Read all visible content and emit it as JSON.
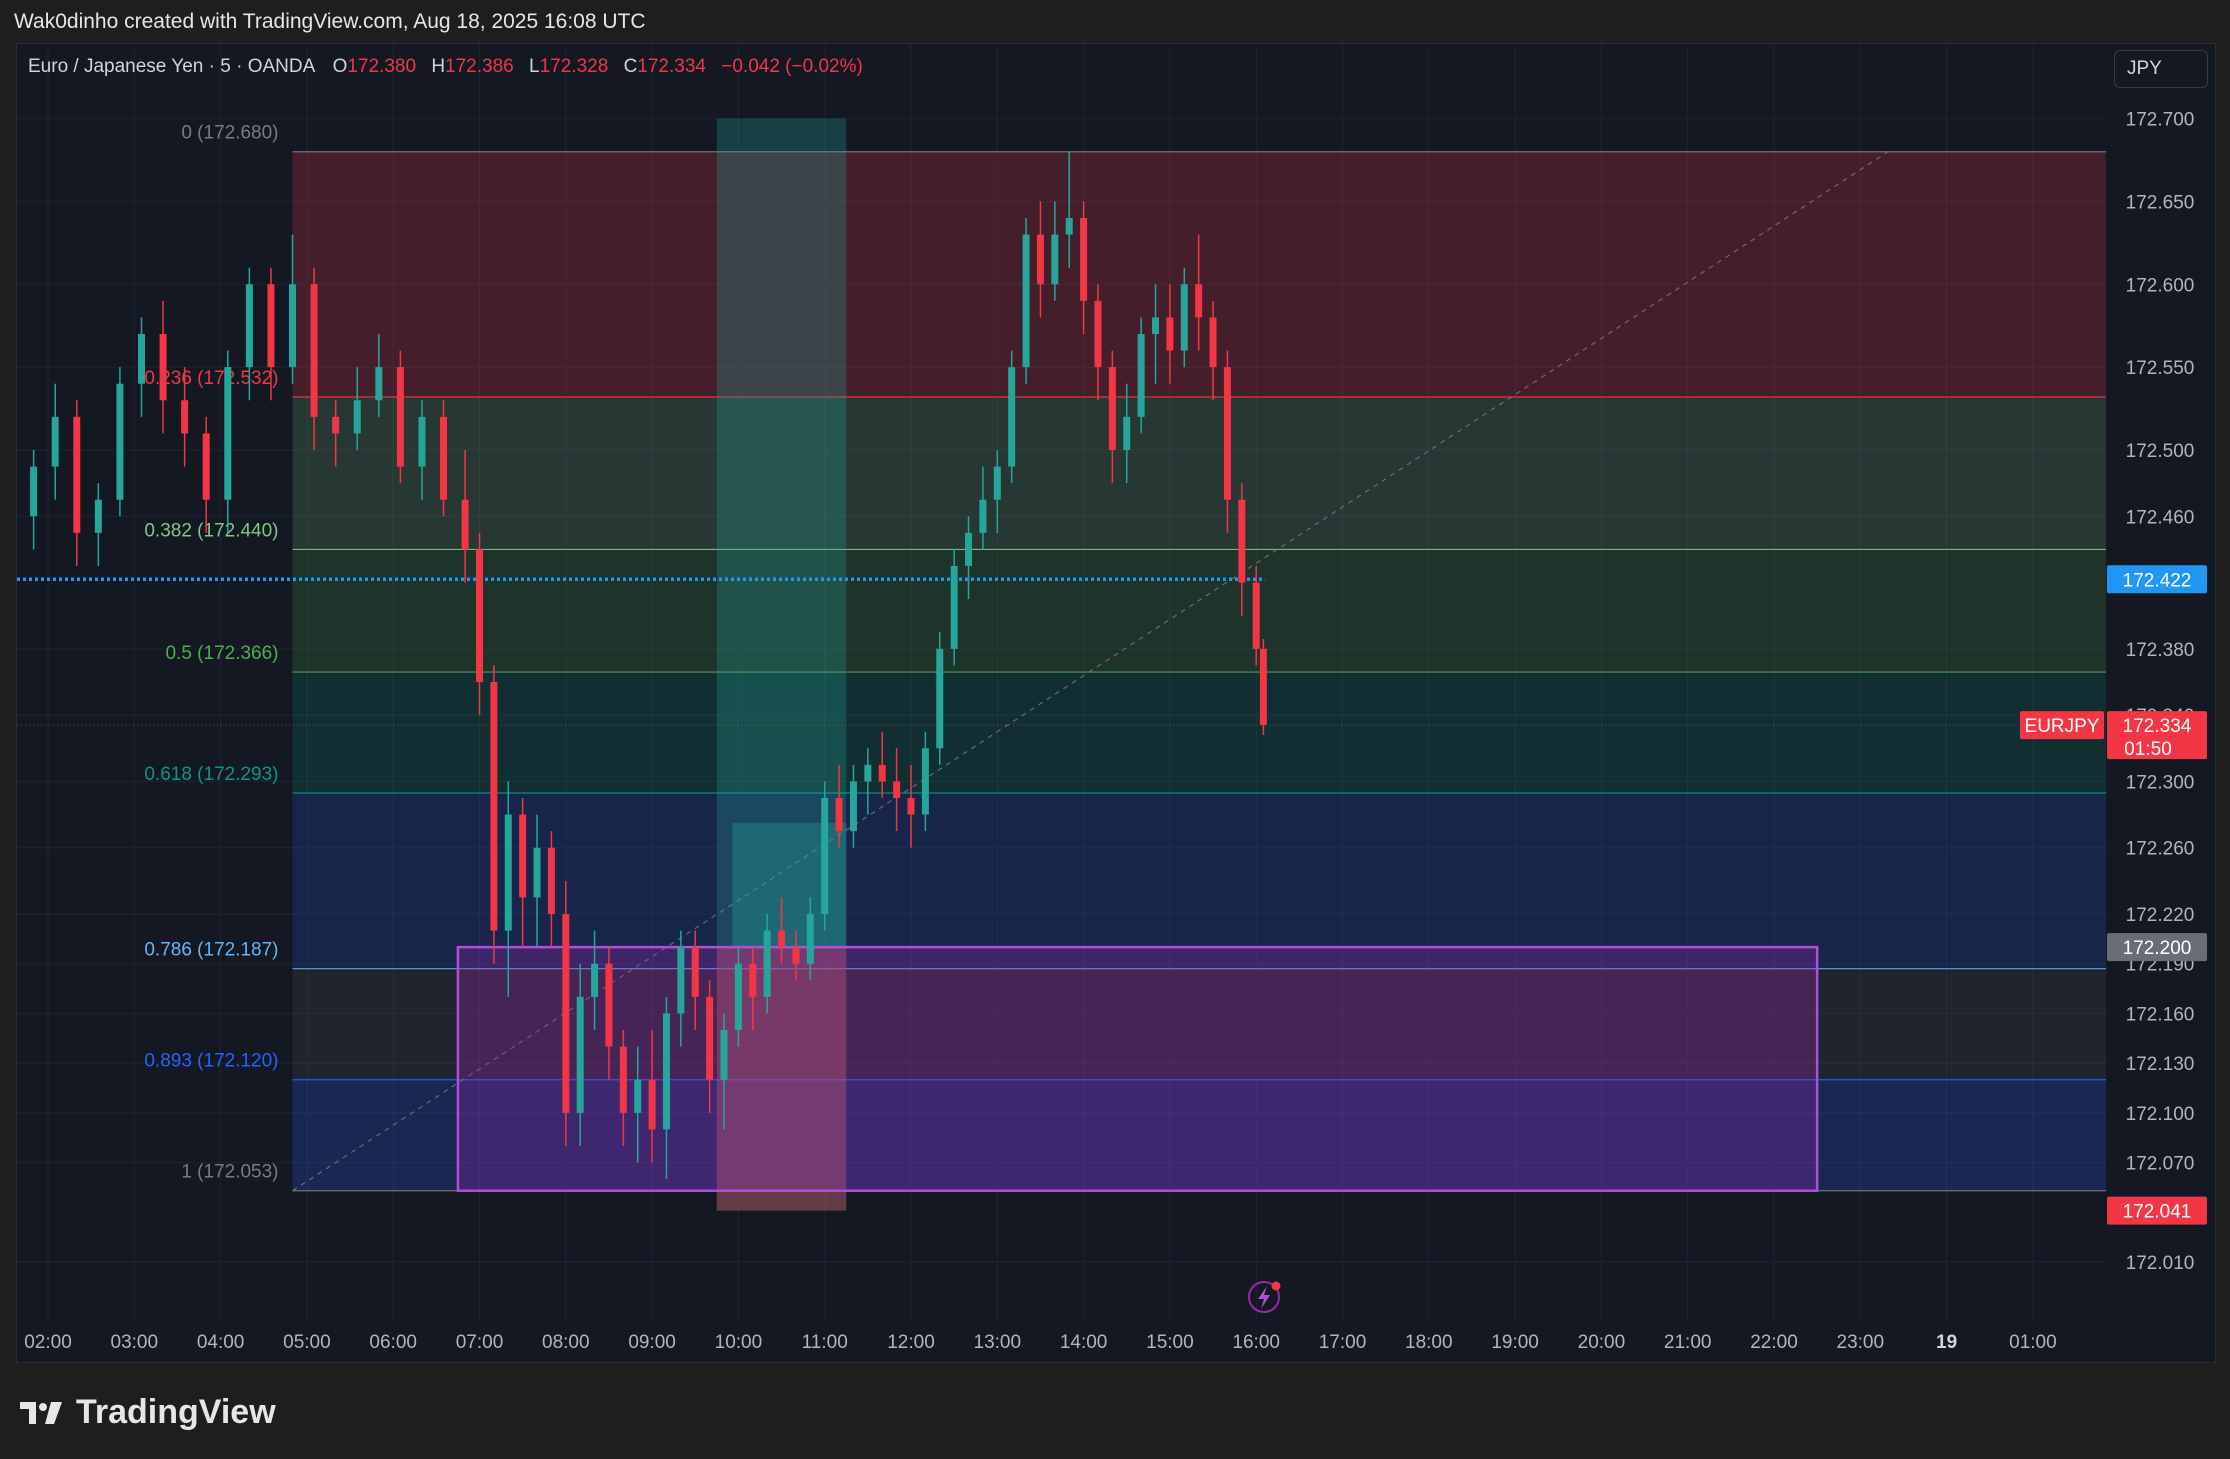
{
  "header": {
    "credit": "Wak0dinho created with TradingView.com, Aug 18, 2025 16:08 UTC"
  },
  "legend": {
    "symbol": "Euro / Japanese Yen · 5 · OANDA",
    "o_label": "O",
    "o_value": "172.380",
    "h_label": "H",
    "h_value": "172.386",
    "l_label": "L",
    "l_value": "172.328",
    "c_label": "C",
    "c_value": "172.334",
    "change": "−0.042 (−0.02%)"
  },
  "currency_button": "JPY",
  "footer": {
    "brand": "TradingView"
  },
  "colors": {
    "up": "#26a69a",
    "down": "#f23645",
    "background": "#141823",
    "accent_blue": "#2962ff",
    "purple": "#9c27b0"
  },
  "chart_data": {
    "type": "candlestick",
    "symbol": "EURJPY",
    "ylim": [
      171.975,
      172.745
    ],
    "y_ticks": [
      "172.700",
      "172.650",
      "172.600",
      "172.550",
      "172.500",
      "172.460",
      "172.380",
      "172.340",
      "172.300",
      "172.260",
      "172.220",
      "172.190",
      "172.160",
      "172.130",
      "172.100",
      "172.070",
      "172.010"
    ],
    "x_ticks": [
      "02:00",
      "03:00",
      "04:00",
      "05:00",
      "06:00",
      "07:00",
      "08:00",
      "09:00",
      "10:00",
      "11:00",
      "12:00",
      "13:00",
      "14:00",
      "15:00",
      "16:00",
      "17:00",
      "18:00",
      "19:00",
      "20:00",
      "21:00",
      "22:00",
      "23:00",
      "19",
      "01:00"
    ],
    "price_badges": [
      {
        "label": "172.422",
        "price": 172.422,
        "color": "#2196f3"
      },
      {
        "label": "172.334",
        "price": 172.334,
        "color": "#f23645",
        "sub": "01:50",
        "tag": "EURJPY"
      },
      {
        "label": "172.200",
        "price": 172.2,
        "color": "#6a6d78"
      },
      {
        "label": "172.041",
        "price": 172.041,
        "color": "#f23645"
      }
    ],
    "fib_levels": [
      {
        "ratio": "0",
        "price": 172.68,
        "label": "0 (172.680)",
        "color": "#787b86"
      },
      {
        "ratio": "0.236",
        "price": 172.532,
        "label": "0.236 (172.532)",
        "color": "#f23645"
      },
      {
        "ratio": "0.382",
        "price": 172.44,
        "label": "0.382 (172.440)",
        "color": "#81c784"
      },
      {
        "ratio": "0.5",
        "price": 172.366,
        "label": "0.5 (172.366)",
        "color": "#4caf50"
      },
      {
        "ratio": "0.618",
        "price": 172.293,
        "label": "0.618 (172.293)",
        "color": "#089981"
      },
      {
        "ratio": "0.786",
        "price": 172.187,
        "label": "0.786 (172.187)",
        "color": "#64b5f6"
      },
      {
        "ratio": "0.893",
        "price": 172.12,
        "label": "0.893 (172.120)",
        "color": "#2962ff"
      },
      {
        "ratio": "1",
        "price": 172.053,
        "label": "1 (172.053)",
        "color": "#787b86"
      }
    ],
    "fib_time_range": [
      "04:50",
      "23:00"
    ],
    "zone": {
      "from_time": "06:45",
      "to_time": "22:30",
      "top": 172.2,
      "bottom": 172.053
    },
    "session_band": {
      "from_time": "09:45",
      "to_time": "11:15",
      "top": 172.7,
      "bottom": 172.041
    },
    "dotted_line": {
      "price": 172.422,
      "from_time": "01:40",
      "to_time": "16:05"
    },
    "ohlc": [
      {
        "t": "01:50",
        "o": 172.46,
        "h": 172.5,
        "l": 172.44,
        "c": 172.49
      },
      {
        "t": "02:05",
        "o": 172.49,
        "h": 172.54,
        "l": 172.47,
        "c": 172.52
      },
      {
        "t": "02:20",
        "o": 172.52,
        "h": 172.53,
        "l": 172.43,
        "c": 172.45
      },
      {
        "t": "02:35",
        "o": 172.45,
        "h": 172.48,
        "l": 172.43,
        "c": 172.47
      },
      {
        "t": "02:50",
        "o": 172.47,
        "h": 172.55,
        "l": 172.46,
        "c": 172.54
      },
      {
        "t": "03:05",
        "o": 172.54,
        "h": 172.58,
        "l": 172.52,
        "c": 172.57
      },
      {
        "t": "03:20",
        "o": 172.57,
        "h": 172.59,
        "l": 172.51,
        "c": 172.53
      },
      {
        "t": "03:35",
        "o": 172.53,
        "h": 172.55,
        "l": 172.49,
        "c": 172.51
      },
      {
        "t": "03:50",
        "o": 172.51,
        "h": 172.52,
        "l": 172.45,
        "c": 172.47
      },
      {
        "t": "04:05",
        "o": 172.47,
        "h": 172.56,
        "l": 172.45,
        "c": 172.55
      },
      {
        "t": "04:20",
        "o": 172.55,
        "h": 172.61,
        "l": 172.53,
        "c": 172.6
      },
      {
        "t": "04:35",
        "o": 172.6,
        "h": 172.61,
        "l": 172.53,
        "c": 172.55
      },
      {
        "t": "04:50",
        "o": 172.55,
        "h": 172.63,
        "l": 172.54,
        "c": 172.6
      },
      {
        "t": "05:05",
        "o": 172.6,
        "h": 172.61,
        "l": 172.5,
        "c": 172.52
      },
      {
        "t": "05:20",
        "o": 172.52,
        "h": 172.53,
        "l": 172.49,
        "c": 172.51
      },
      {
        "t": "05:35",
        "o": 172.51,
        "h": 172.55,
        "l": 172.5,
        "c": 172.53
      },
      {
        "t": "05:50",
        "o": 172.53,
        "h": 172.57,
        "l": 172.52,
        "c": 172.55
      },
      {
        "t": "06:05",
        "o": 172.55,
        "h": 172.56,
        "l": 172.48,
        "c": 172.49
      },
      {
        "t": "06:20",
        "o": 172.49,
        "h": 172.53,
        "l": 172.47,
        "c": 172.52
      },
      {
        "t": "06:35",
        "o": 172.52,
        "h": 172.53,
        "l": 172.46,
        "c": 172.47
      },
      {
        "t": "06:50",
        "o": 172.47,
        "h": 172.5,
        "l": 172.42,
        "c": 172.44
      },
      {
        "t": "07:00",
        "o": 172.44,
        "h": 172.45,
        "l": 172.34,
        "c": 172.36
      },
      {
        "t": "07:10",
        "o": 172.36,
        "h": 172.37,
        "l": 172.19,
        "c": 172.21
      },
      {
        "t": "07:20",
        "o": 172.21,
        "h": 172.3,
        "l": 172.17,
        "c": 172.28
      },
      {
        "t": "07:30",
        "o": 172.28,
        "h": 172.29,
        "l": 172.2,
        "c": 172.23
      },
      {
        "t": "07:40",
        "o": 172.23,
        "h": 172.28,
        "l": 172.2,
        "c": 172.26
      },
      {
        "t": "07:50",
        "o": 172.26,
        "h": 172.27,
        "l": 172.2,
        "c": 172.22
      },
      {
        "t": "08:00",
        "o": 172.22,
        "h": 172.24,
        "l": 172.08,
        "c": 172.1
      },
      {
        "t": "08:10",
        "o": 172.1,
        "h": 172.19,
        "l": 172.08,
        "c": 172.17
      },
      {
        "t": "08:20",
        "o": 172.17,
        "h": 172.21,
        "l": 172.15,
        "c": 172.19
      },
      {
        "t": "08:30",
        "o": 172.19,
        "h": 172.2,
        "l": 172.12,
        "c": 172.14
      },
      {
        "t": "08:40",
        "o": 172.14,
        "h": 172.15,
        "l": 172.08,
        "c": 172.1
      },
      {
        "t": "08:50",
        "o": 172.1,
        "h": 172.14,
        "l": 172.07,
        "c": 172.12
      },
      {
        "t": "09:00",
        "o": 172.12,
        "h": 172.15,
        "l": 172.07,
        "c": 172.09
      },
      {
        "t": "09:10",
        "o": 172.09,
        "h": 172.17,
        "l": 172.06,
        "c": 172.16
      },
      {
        "t": "09:20",
        "o": 172.16,
        "h": 172.21,
        "l": 172.14,
        "c": 172.2
      },
      {
        "t": "09:30",
        "o": 172.2,
        "h": 172.21,
        "l": 172.15,
        "c": 172.17
      },
      {
        "t": "09:40",
        "o": 172.17,
        "h": 172.18,
        "l": 172.1,
        "c": 172.12
      },
      {
        "t": "09:50",
        "o": 172.12,
        "h": 172.16,
        "l": 172.09,
        "c": 172.15
      },
      {
        "t": "10:00",
        "o": 172.15,
        "h": 172.2,
        "l": 172.14,
        "c": 172.19
      },
      {
        "t": "10:10",
        "o": 172.19,
        "h": 172.2,
        "l": 172.15,
        "c": 172.17
      },
      {
        "t": "10:20",
        "o": 172.17,
        "h": 172.22,
        "l": 172.16,
        "c": 172.21
      },
      {
        "t": "10:30",
        "o": 172.21,
        "h": 172.23,
        "l": 172.19,
        "c": 172.2
      },
      {
        "t": "10:40",
        "o": 172.2,
        "h": 172.21,
        "l": 172.18,
        "c": 172.19
      },
      {
        "t": "10:50",
        "o": 172.19,
        "h": 172.23,
        "l": 172.18,
        "c": 172.22
      },
      {
        "t": "11:00",
        "o": 172.22,
        "h": 172.3,
        "l": 172.21,
        "c": 172.29
      },
      {
        "t": "11:10",
        "o": 172.29,
        "h": 172.31,
        "l": 172.26,
        "c": 172.27
      },
      {
        "t": "11:20",
        "o": 172.27,
        "h": 172.31,
        "l": 172.26,
        "c": 172.3
      },
      {
        "t": "11:30",
        "o": 172.3,
        "h": 172.32,
        "l": 172.28,
        "c": 172.31
      },
      {
        "t": "11:40",
        "o": 172.31,
        "h": 172.33,
        "l": 172.29,
        "c": 172.3
      },
      {
        "t": "11:50",
        "o": 172.3,
        "h": 172.32,
        "l": 172.27,
        "c": 172.29
      },
      {
        "t": "12:00",
        "o": 172.29,
        "h": 172.31,
        "l": 172.26,
        "c": 172.28
      },
      {
        "t": "12:10",
        "o": 172.28,
        "h": 172.33,
        "l": 172.27,
        "c": 172.32
      },
      {
        "t": "12:20",
        "o": 172.32,
        "h": 172.39,
        "l": 172.31,
        "c": 172.38
      },
      {
        "t": "12:30",
        "o": 172.38,
        "h": 172.44,
        "l": 172.37,
        "c": 172.43
      },
      {
        "t": "12:40",
        "o": 172.43,
        "h": 172.46,
        "l": 172.41,
        "c": 172.45
      },
      {
        "t": "12:50",
        "o": 172.45,
        "h": 172.49,
        "l": 172.44,
        "c": 172.47
      },
      {
        "t": "13:00",
        "o": 172.47,
        "h": 172.5,
        "l": 172.45,
        "c": 172.49
      },
      {
        "t": "13:10",
        "o": 172.49,
        "h": 172.56,
        "l": 172.48,
        "c": 172.55
      },
      {
        "t": "13:20",
        "o": 172.55,
        "h": 172.64,
        "l": 172.54,
        "c": 172.63
      },
      {
        "t": "13:30",
        "o": 172.63,
        "h": 172.65,
        "l": 172.58,
        "c": 172.6
      },
      {
        "t": "13:40",
        "o": 172.6,
        "h": 172.65,
        "l": 172.59,
        "c": 172.63
      },
      {
        "t": "13:50",
        "o": 172.63,
        "h": 172.68,
        "l": 172.61,
        "c": 172.64
      },
      {
        "t": "14:00",
        "o": 172.64,
        "h": 172.65,
        "l": 172.57,
        "c": 172.59
      },
      {
        "t": "14:10",
        "o": 172.59,
        "h": 172.6,
        "l": 172.53,
        "c": 172.55
      },
      {
        "t": "14:20",
        "o": 172.55,
        "h": 172.56,
        "l": 172.48,
        "c": 172.5
      },
      {
        "t": "14:30",
        "o": 172.5,
        "h": 172.54,
        "l": 172.48,
        "c": 172.52
      },
      {
        "t": "14:40",
        "o": 172.52,
        "h": 172.58,
        "l": 172.51,
        "c": 172.57
      },
      {
        "t": "14:50",
        "o": 172.57,
        "h": 172.6,
        "l": 172.54,
        "c": 172.58
      },
      {
        "t": "15:00",
        "o": 172.58,
        "h": 172.6,
        "l": 172.54,
        "c": 172.56
      },
      {
        "t": "15:10",
        "o": 172.56,
        "h": 172.61,
        "l": 172.55,
        "c": 172.6
      },
      {
        "t": "15:20",
        "o": 172.6,
        "h": 172.63,
        "l": 172.56,
        "c": 172.58
      },
      {
        "t": "15:30",
        "o": 172.58,
        "h": 172.59,
        "l": 172.53,
        "c": 172.55
      },
      {
        "t": "15:40",
        "o": 172.55,
        "h": 172.56,
        "l": 172.45,
        "c": 172.47
      },
      {
        "t": "15:50",
        "o": 172.47,
        "h": 172.48,
        "l": 172.4,
        "c": 172.42
      },
      {
        "t": "16:00",
        "o": 172.42,
        "h": 172.43,
        "l": 172.37,
        "c": 172.38
      },
      {
        "t": "16:05",
        "o": 172.38,
        "h": 172.386,
        "l": 172.328,
        "c": 172.334
      }
    ]
  }
}
